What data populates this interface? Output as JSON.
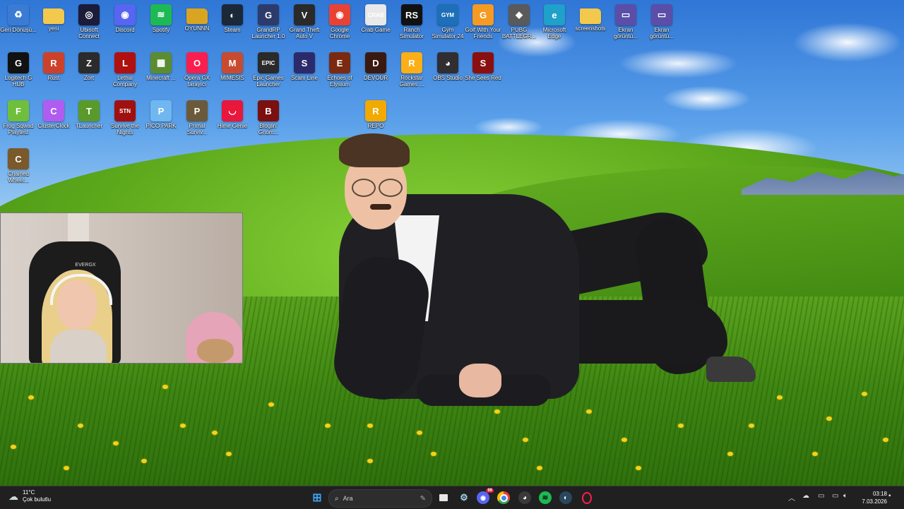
{
  "desktop": {
    "icons": [
      {
        "label": "Geri Dönüşü...",
        "glyph": "♻",
        "color": "#3a7bd5",
        "icon": "recycle-bin-icon"
      },
      {
        "label": "yeni",
        "glyph": "",
        "color": "#f2c94c",
        "icon": "folder-icon"
      },
      {
        "label": "Ubisoft Connect",
        "glyph": "◎",
        "color": "#1b1b3a",
        "icon": "ubisoft-icon"
      },
      {
        "label": "Discord",
        "glyph": "◉",
        "color": "#5865f2",
        "icon": "discord-icon"
      },
      {
        "label": "Spotify",
        "glyph": "≋",
        "color": "#1db954",
        "icon": "spotify-icon"
      },
      {
        "label": "OYUNNN",
        "glyph": "",
        "color": "#d9a520",
        "icon": "folder-icon"
      },
      {
        "label": "Steam",
        "glyph": "◐",
        "color": "#1b2838",
        "icon": "steam-icon"
      },
      {
        "label": "GrandRP Launcher 1.0",
        "glyph": "G",
        "color": "#2d3b6b",
        "icon": "grandrp-icon"
      },
      {
        "label": "Grand Theft Auto V",
        "glyph": "V",
        "color": "#2a2a2a",
        "icon": "gta-icon"
      },
      {
        "label": "Google Chrome",
        "glyph": "◉",
        "color": "#e94235",
        "icon": "chrome-icon"
      },
      {
        "label": "Crab Game",
        "glyph": "CRAB",
        "color": "#e8e8e8",
        "icon": "crab-game-icon"
      },
      {
        "label": "Ranch Simulator",
        "glyph": "RS",
        "color": "#111111",
        "icon": "ranch-simulator-icon"
      },
      {
        "label": "Gym Simulator 24",
        "glyph": "GYM",
        "color": "#1d6fb8",
        "icon": "gym-simulator-icon"
      },
      {
        "label": "Golf With Your Friends",
        "glyph": "G",
        "color": "#f59a23",
        "icon": "golf-icon"
      },
      {
        "label": "PUBG BATTLEGR...",
        "glyph": "◆",
        "color": "#5a5a5a",
        "icon": "pubg-icon"
      },
      {
        "label": "Microsoft Edge",
        "glyph": "e",
        "color": "#1fa1c9",
        "icon": "edge-icon"
      },
      {
        "label": "screenshots",
        "glyph": "",
        "color": "#f2c94c",
        "icon": "folder-icon"
      },
      {
        "label": "Ekran görüntü...",
        "glyph": "▭",
        "color": "#5a4ea8",
        "icon": "screenshot-file-icon"
      },
      {
        "label": "Ekran görüntü...",
        "glyph": "▭",
        "color": "#5a4ea8",
        "icon": "screenshot-file-icon"
      },
      {
        "label": "Logitech G HUB",
        "glyph": "G",
        "color": "#111111",
        "icon": "logitech-icon"
      },
      {
        "label": "Rust",
        "glyph": "R",
        "color": "#cd412b",
        "icon": "rust-icon"
      },
      {
        "label": "Zort",
        "glyph": "Z",
        "color": "#2b2b2b",
        "icon": "zort-icon"
      },
      {
        "label": "Lethal Company",
        "glyph": "L",
        "color": "#b01010",
        "icon": "lethal-company-icon"
      },
      {
        "label": "Minecraft ...",
        "glyph": "▦",
        "color": "#5b8c32",
        "icon": "minecraft-icon"
      },
      {
        "label": "Opera GX tarayıcı",
        "glyph": "O",
        "color": "#fa1e4e",
        "icon": "opera-gx-icon"
      },
      {
        "label": "MIMESIS",
        "glyph": "M",
        "color": "#c84b2f",
        "icon": "mimesis-icon"
      },
      {
        "label": "Epic Games Launcher",
        "glyph": "EPIC",
        "color": "#2a2a2a",
        "icon": "epic-games-icon"
      },
      {
        "label": "Scam Line",
        "glyph": "S",
        "color": "#2b2b6b",
        "icon": "scam-line-icon"
      },
      {
        "label": "Echoes of Elysium",
        "glyph": "E",
        "color": "#7a2a10",
        "icon": "echoes-icon"
      },
      {
        "label": "DEVOUR",
        "glyph": "D",
        "color": "#3a1a10",
        "icon": "devour-icon"
      },
      {
        "label": "Rockstar Games ...",
        "glyph": "R",
        "color": "#fcaf17",
        "icon": "rockstar-icon"
      },
      {
        "label": "OBS Studio",
        "glyph": "◕",
        "color": "#302e31",
        "icon": "obs-icon"
      },
      {
        "label": "She Sees Red",
        "glyph": "S",
        "color": "#8a1010",
        "icon": "she-sees-red-icon"
      },
      {
        "label": "Frog Sqwad Playtest",
        "glyph": "F",
        "color": "#6fbf3c",
        "icon": "frog-sqwad-icon"
      },
      {
        "label": "ClusterClock",
        "glyph": "C",
        "color": "#b05cf0",
        "icon": "clusterclock-icon"
      },
      {
        "label": "TLauncher",
        "glyph": "T",
        "color": "#5a9a2a",
        "icon": "tlauncher-icon"
      },
      {
        "label": "Survive the Nights",
        "glyph": "STN",
        "color": "#a01010",
        "icon": "survive-nights-icon"
      },
      {
        "label": "PICO PARK",
        "glyph": "P",
        "color": "#6fb7f0",
        "icon": "pico-park-icon"
      },
      {
        "label": "Primal Surviv...",
        "glyph": "P",
        "color": "#6a5a3a",
        "icon": "primal-survival-icon"
      },
      {
        "label": "Hime Genie",
        "glyph": "◡",
        "color": "#e8173b",
        "icon": "hime-genie-icon"
      },
      {
        "label": "Bloglin' Gnom...",
        "glyph": "B",
        "color": "#7a1010",
        "icon": "gnome-icon"
      },
      {
        "label": "REPO",
        "glyph": "R",
        "color": "#f2a900",
        "icon": "repo-icon"
      },
      {
        "label": "Chained Wheel...",
        "glyph": "C",
        "color": "#7a5a2a",
        "icon": "chained-wheels-icon"
      }
    ]
  },
  "webcam": {
    "chair_brand": "EVERGX"
  },
  "taskbar": {
    "weather_temp": "11°C",
    "weather_desc": "Çok bulutlu",
    "search_placeholder": "Ara",
    "clock_time": "03:18",
    "clock_date": "7.03.2026",
    "apps": [
      {
        "name": "start-button",
        "glyph": "⊞",
        "color": "#3ca0f0",
        "fg": "#3ca0f0",
        "bg": "transparent"
      },
      {
        "name": "file-explorer-button",
        "glyph": "▬",
        "color": "#f2c94c",
        "fg": "#f2c94c",
        "bg": "transparent"
      },
      {
        "name": "settings-button",
        "glyph": "⚙",
        "color": "#cfd8dc",
        "fg": "#9fd0e8",
        "bg": "transparent"
      },
      {
        "name": "discord-taskbar-button",
        "glyph": "◉",
        "color": "#5865f2",
        "fg": "#fff",
        "bg": "#5865f2"
      },
      {
        "name": "chrome-taskbar-button",
        "glyph": "◉",
        "color": "#e94235",
        "fg": "#fff",
        "bg": "#e94235"
      },
      {
        "name": "obs-taskbar-button",
        "glyph": "◕",
        "color": "#444444",
        "fg": "#fff",
        "bg": "#444"
      },
      {
        "name": "spotify-taskbar-button",
        "glyph": "≋",
        "color": "#1db954",
        "fg": "#fff",
        "bg": "#1db954"
      },
      {
        "name": "steam-taskbar-button",
        "glyph": "◐",
        "color": "#1b2838",
        "fg": "#fff",
        "bg": "#2a475e"
      },
      {
        "name": "opera-taskbar-button",
        "glyph": "O",
        "color": "#fa1e4e",
        "fg": "#fa1e4e",
        "bg": "transparent"
      }
    ],
    "discord_badge": "99"
  }
}
